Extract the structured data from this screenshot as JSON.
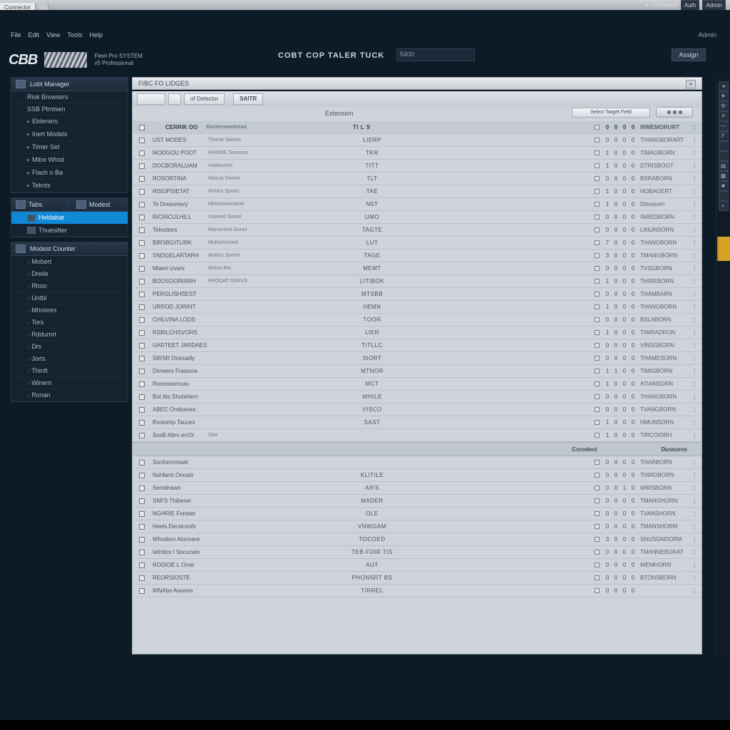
{
  "window": {
    "tab": "Connector",
    "topright_a": "Connector",
    "topright_b": "Auth",
    "topright_c": "Admin"
  },
  "menu": {
    "items": [
      "File",
      "Edit",
      "View",
      "Tools",
      "Help"
    ],
    "right": "Admin"
  },
  "brand": {
    "logo": "CBB",
    "sub1": "Fleet Pro SYSTEM",
    "sub2": "v5 Professional"
  },
  "header": {
    "title": "COBT COP TALER TUCK",
    "field": "5400",
    "action": "Assign"
  },
  "sidebar": {
    "panel1": {
      "title": "Lobt Manager",
      "items": [
        "Risk Browsers",
        "SSB Ptmtsen",
        "Ebteners",
        "Inert Models",
        "Timer Set",
        "Mitre Whist",
        "Flash o Ba",
        "Teknts"
      ]
    },
    "panel2": {
      "title_a": "Tabs",
      "title_b": "Modest",
      "items": [
        "Heldabar",
        "Thuesitter"
      ],
      "sel_index": 0
    },
    "panel3": {
      "title": "Modest Counter",
      "items": [
        "Mobert",
        "Dreile",
        "Rhoo",
        "Untbl",
        "Mhnores",
        "Tors",
        "Rddumrt",
        "Drs",
        "Jorts",
        "Thinft",
        "Winem",
        "Ronan"
      ]
    }
  },
  "page": {
    "title": "FIBC FO LIDGES",
    "close": "×"
  },
  "toolbar": {
    "btns": [
      "",
      "",
      "of Detector",
      "SAITR"
    ]
  },
  "grid": {
    "ext_header": "Extension",
    "filter_btn": "Select Target Field",
    "group1_label": "CERRIK OO",
    "group1_desc": "Donternomitread",
    "group1_center": "TI L S",
    "rows1": [
      {
        "code": "UST MODES",
        "desc": "Thorne Sitonet",
        "ext": "LIERP",
        "n": [
          "0",
          "0",
          "0",
          "0"
        ],
        "id": "THANGBORART"
      },
      {
        "code": "MODGOU POOT",
        "desc": "HINNSE Sononss",
        "ext": "TKR",
        "n": [
          "1",
          "0",
          "0",
          "0"
        ],
        "id": "TIMAGBORN"
      },
      {
        "code": "DOCBORALUAM",
        "desc": "Indatturorb",
        "ext": "TITT",
        "n": [
          "1",
          "0",
          "0",
          "0"
        ],
        "id": "DTRISBOOT"
      },
      {
        "code": "ROSORTINA",
        "desc": "Nilorus Domirt",
        "ext": "TLT",
        "n": [
          "0",
          "0",
          "0",
          "0"
        ],
        "id": "BSRABORN"
      },
      {
        "code": "RISOPSIETAT",
        "desc": "Ahlons Spsort",
        "ext": "TAE",
        "n": [
          "1",
          "0",
          "0",
          "0"
        ],
        "id": "HOBAGERT"
      },
      {
        "code": "Te Dresomery",
        "desc": "Mhoememnenel",
        "ext": "N5T",
        "n": [
          "1",
          "0",
          "0",
          "0"
        ],
        "id": "Ditonsorn"
      },
      {
        "code": "RICRICULHILL",
        "desc": "Untrend Somel",
        "ext": "UMO",
        "n": [
          "0",
          "0",
          "0",
          "0"
        ],
        "id": "INREDBORN"
      },
      {
        "code": "Telnotters",
        "desc": "Marvorene Gonet",
        "ext": "TAGTE",
        "n": [
          "0",
          "0",
          "0",
          "0"
        ],
        "id": "LINUNSORN"
      },
      {
        "code": "BIRSBGITLIRK",
        "desc": "Multorforrood",
        "ext": "LUT",
        "n": [
          "7",
          "0",
          "0",
          "0"
        ],
        "id": "THANGBORN"
      },
      {
        "code": "SNDGELARTARH",
        "desc": "Mottorr Somel",
        "ext": "TAGE",
        "n": [
          "3",
          "0",
          "0",
          "0"
        ],
        "id": "TMANGBORN"
      },
      {
        "code": "Mlaerl Uvers",
        "desc": "Moturl Rel",
        "ext": "MEMT",
        "n": [
          "0",
          "0",
          "0",
          "0"
        ],
        "id": "TVSGBORN"
      },
      {
        "code": "BOOSOORIARH",
        "desc": "FROOAT DURVS",
        "ext": "LITIBOK",
        "n": [
          "1",
          "0",
          "0",
          "0"
        ],
        "id": "THIREBORN"
      },
      {
        "code": "PERGLISHSEST",
        "desc": "",
        "ext": "MTSBB",
        "n": [
          "0",
          "0",
          "0",
          "0"
        ],
        "id": "THAMBARN"
      },
      {
        "code": "URROD JORINT",
        "desc": "",
        "ext": "IIEMN",
        "n": [
          "1",
          "0",
          "0",
          "0"
        ],
        "id": "THANGBORN"
      },
      {
        "code": "CHILVINA LODS",
        "desc": "",
        "ext": "TOOR",
        "n": [
          "0",
          "0",
          "0",
          "0"
        ],
        "id": "BSLABORN"
      },
      {
        "code": "RSBILCHSVORS",
        "desc": "",
        "ext": "LIER",
        "n": [
          "1",
          "0",
          "0",
          "0"
        ],
        "id": "TIWRADRON"
      },
      {
        "code": "UARTEET JARDAES",
        "desc": "",
        "ext": "TITLLC",
        "n": [
          "0",
          "0",
          "0",
          "0"
        ],
        "id": "VINSGBORN"
      },
      {
        "code": "SIRSR Doesailly",
        "desc": "",
        "ext": "SIORT",
        "n": [
          "0",
          "0",
          "0",
          "0"
        ],
        "id": "THAMESORN"
      },
      {
        "code": "Dimeers Fraisona",
        "desc": "",
        "ext": "MTNOR",
        "n": [
          "1",
          "1",
          "0",
          "0"
        ],
        "id": "TIMIGBORN"
      },
      {
        "code": "Rooossomcas",
        "desc": "",
        "ext": "MCT",
        "n": [
          "1",
          "0",
          "0",
          "0"
        ],
        "id": "ATIANSORN"
      },
      {
        "code": "But tbs Shotshern",
        "desc": "",
        "ext": "WHILE",
        "n": [
          "0",
          "0",
          "0",
          "0"
        ],
        "id": "THANGBORN"
      },
      {
        "code": "ABEC Ondsanes",
        "desc": "",
        "ext": "VISCO",
        "n": [
          "0",
          "0",
          "0",
          "0"
        ],
        "id": "TVANGBORN"
      },
      {
        "code": "Rvotomp Tauces",
        "desc": "",
        "ext": "SAST",
        "n": [
          "1",
          "0",
          "0",
          "0"
        ],
        "id": "HMUNSORN"
      },
      {
        "code": "SosB Abro errOr",
        "desc": "Gler",
        "ext": "",
        "n": [
          "1",
          "0",
          "0",
          "0"
        ],
        "id": "TIRCOIDRH"
      }
    ],
    "section2": {
      "left": "Corodest",
      "right": "Dussures"
    },
    "rows2": [
      {
        "code": "Sonformmiaet",
        "desc": "",
        "ext": "",
        "n": [
          "0",
          "0",
          "0",
          "0"
        ],
        "id": "THARBORN"
      },
      {
        "code": "Nshfamt Onoslo",
        "desc": "",
        "ext": "KLITILE",
        "n": [
          "0",
          "0",
          "0",
          "0"
        ],
        "id": "THIRDBORN"
      },
      {
        "code": "Seriotheart",
        "desc": "",
        "ext": "AIFS",
        "n": [
          "0",
          "0",
          "1",
          "0"
        ],
        "id": "WIRSBORN"
      },
      {
        "code": "SNFS Thibeser",
        "desc": "",
        "ext": "MADER",
        "n": [
          "0",
          "0",
          "0",
          "0"
        ],
        "id": "TMANGHORN"
      },
      {
        "code": "NGHRIE Fonster",
        "desc": "",
        "ext": "OLE",
        "n": [
          "0",
          "0",
          "0",
          "0"
        ],
        "id": "TVANSHORN"
      },
      {
        "code": "Heels Derstroorb",
        "desc": "",
        "ext": "VNWGAM",
        "n": [
          "0",
          "0",
          "0",
          "0"
        ],
        "id": "TMANSHORM"
      },
      {
        "code": "Whodern Alonnere",
        "desc": "",
        "ext": "TOCOED",
        "n": [
          "3",
          "0",
          "0",
          "0"
        ],
        "id": "SNUSGNDORM"
      },
      {
        "code": "Iethttos I Socurses",
        "desc": "",
        "ext": "TEB FOIR TIS",
        "n": [
          "0",
          "0",
          "0",
          "0"
        ],
        "id": "TMANNEBORAT"
      },
      {
        "code": "RODIOE L Orrer",
        "desc": "",
        "ext": "AUT",
        "n": [
          "0",
          "0",
          "0",
          "0"
        ],
        "id": "WEMHORN"
      },
      {
        "code": "REORSIOSTE",
        "desc": "",
        "ext": "PHONSRT BS",
        "n": [
          "0",
          "0",
          "0",
          "0"
        ],
        "id": "BTONSBORN"
      },
      {
        "code": "WNAbs Aouoon",
        "desc": "",
        "ext": "TIRREL",
        "n": [
          "0",
          "0",
          "0",
          "0"
        ],
        "id": ""
      }
    ]
  },
  "rail": {
    "icons": [
      "◂",
      "★",
      "⚙",
      "✕",
      "—",
      "F",
      "",
      "",
      "▤",
      "▦",
      "■",
      "",
      "◐"
    ]
  }
}
